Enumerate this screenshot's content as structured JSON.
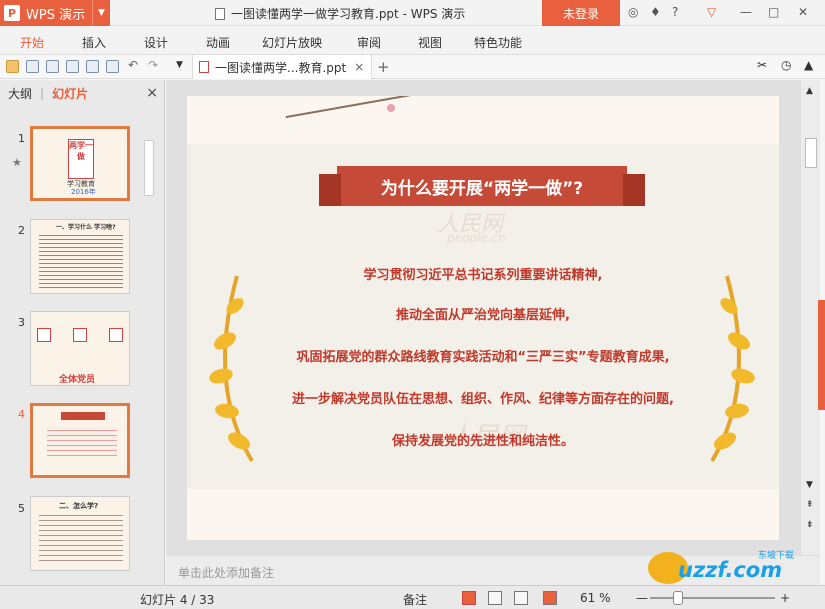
{
  "app": {
    "name": "WPS 演示",
    "logo_letter": "P",
    "title": "一图读懂两学一做学习教育.ppt - WPS 演示",
    "login_label": "未登录"
  },
  "menu": [
    "开始",
    "插入",
    "设计",
    "动画",
    "幻灯片放映",
    "审阅",
    "视图",
    "特色功能"
  ],
  "doc_tab": {
    "label": "一图读懂两学...教育.ppt",
    "close": "×",
    "add": "+"
  },
  "left_pane": {
    "tabs": [
      "大纲",
      "幻灯片"
    ],
    "separator": "|",
    "close": "×"
  },
  "thumbs": [
    {
      "num": "1",
      "title": "两学一做",
      "sub": "学习教育",
      "year": "2016年"
    },
    {
      "num": "2",
      "title": "一、学习什么 学习啥?"
    },
    {
      "num": "3",
      "title": "全体党员"
    },
    {
      "num": "4",
      "title": ""
    },
    {
      "num": "5",
      "title": "二、怎么学?"
    }
  ],
  "slide": {
    "heading": "为什么要开展“两学一做”?",
    "watermark1": "人民网",
    "watermark2": "people.cn",
    "lines": [
      "学习贯彻习近平总书记系列重要讲话精神,",
      "推动全面从严治党向基层延伸,",
      "巩固拓展党的群众路线教育实践活动和“三严三实”专题教育成果,",
      "进一步解决党员队伍在思想、组织、作风、纪律等方面存在的问题,",
      "保持发展党的先进性和纯洁性。"
    ]
  },
  "notes_placeholder": "单击此处添加备注",
  "status": {
    "slide_count": "幻灯片 4 / 33",
    "notes_label": "备注",
    "zoom": "61 %",
    "minus": "—",
    "plus": "+"
  },
  "colors": {
    "accent": "#e8603d",
    "ribbon": "#c54a38",
    "text_red": "#c0392b"
  },
  "watermark_site": {
    "text": "uzzf.com",
    "cn": "东坡下载"
  }
}
